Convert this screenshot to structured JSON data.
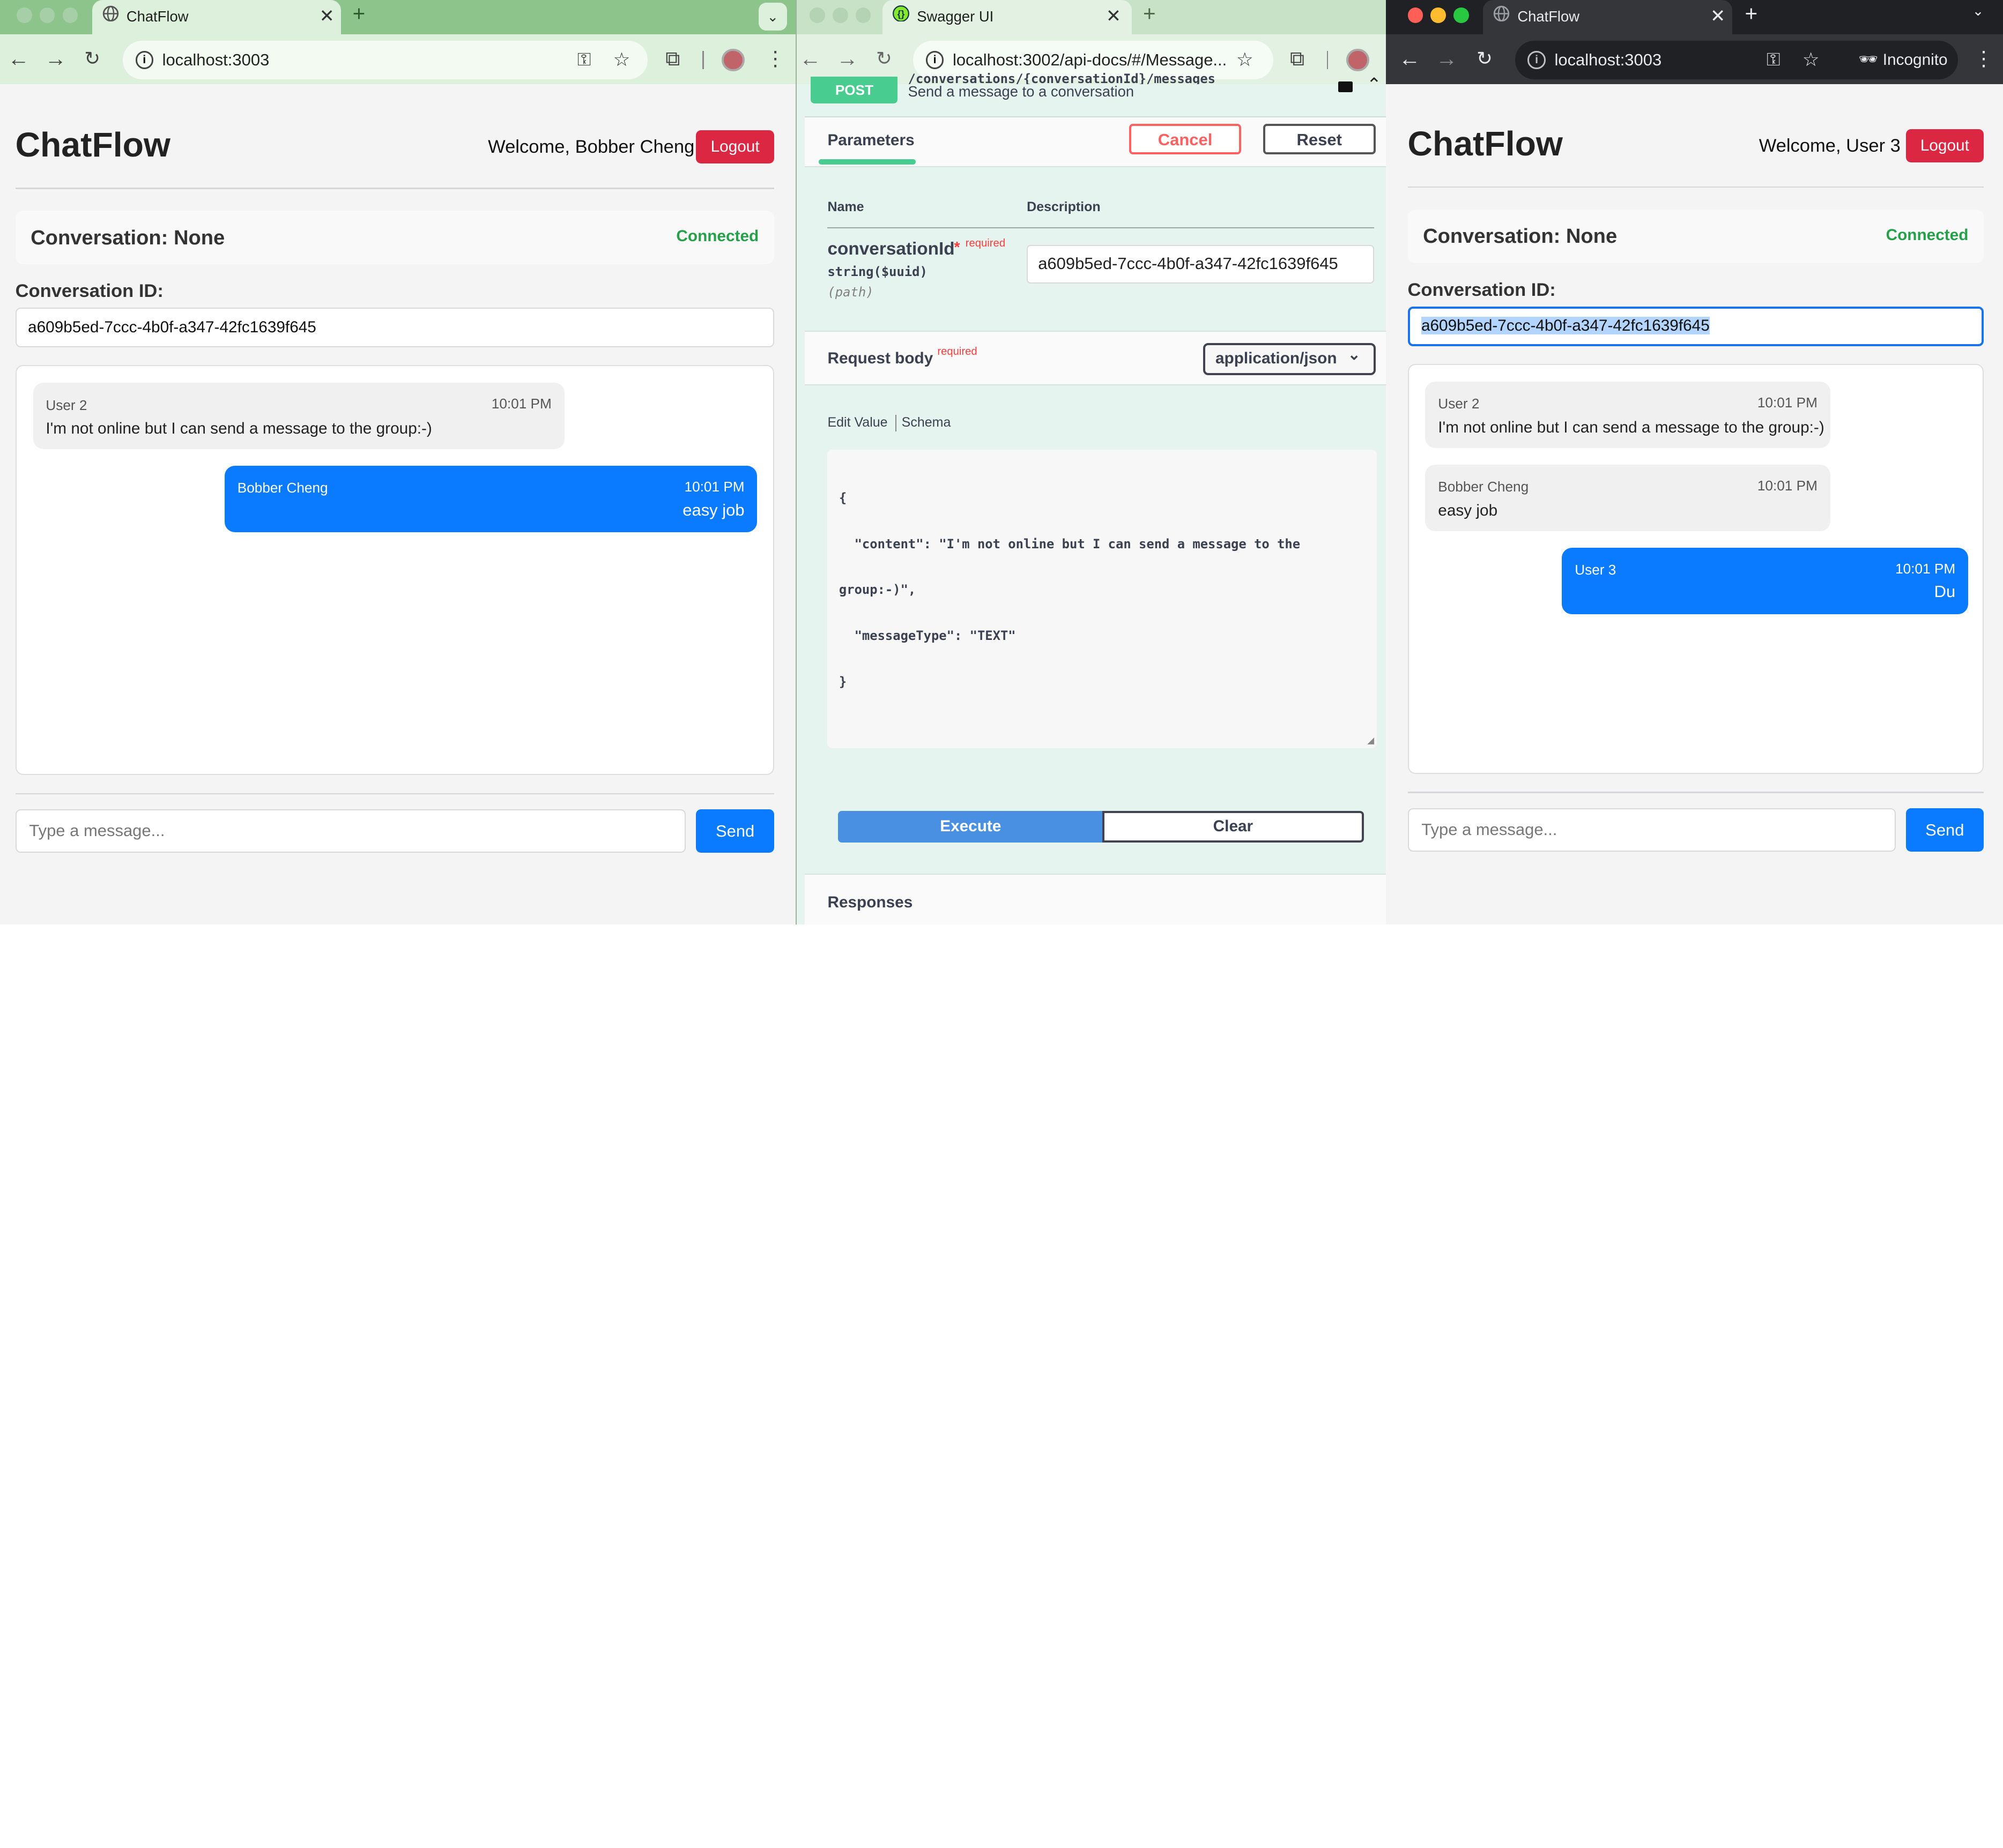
{
  "left": {
    "tab_title": "ChatFlow",
    "url": "localhost:3003",
    "app_title": "ChatFlow",
    "welcome": "Welcome, Bobber Cheng",
    "logout": "Logout",
    "conversation_title": "Conversation: None",
    "status": "Connected",
    "conv_id_label": "Conversation ID:",
    "conv_id_value": "a609b5ed-7ccc-4b0f-a347-42fc1639f645",
    "messages": [
      {
        "from": "User 2",
        "time": "10:01 PM",
        "body": "I'm not online but I can send a message to the group:-)"
      },
      {
        "from": "Bobber Cheng",
        "time": "10:01 PM",
        "body": "easy job"
      }
    ],
    "compose_placeholder": "Type a message...",
    "send": "Send"
  },
  "middle": {
    "tab_title": "Swagger UI",
    "url": "localhost:3002/api-docs/#/Message...",
    "method": "POST",
    "path": "/conversations/{conversationId}/messages",
    "summary": "Send a message to a conversation",
    "parameters_tab": "Parameters",
    "cancel": "Cancel",
    "reset": "Reset",
    "col_name": "Name",
    "col_description": "Description",
    "param_name": "conversationId",
    "param_required_star": "*",
    "param_required": "required",
    "param_type": "string($uuid)",
    "param_in": "(path)",
    "param_value": "a609b5ed-7ccc-4b0f-a347-42fc1639f645",
    "request_body": "Request body",
    "request_body_required": "required",
    "content_type": "application/json",
    "edit_value": "Edit Value",
    "schema": "Schema",
    "body_lines": [
      "{",
      "  \"content\": \"I'm not online but I can send a message to the",
      "group:-)\",",
      "  \"messageType\": \"TEXT\"",
      "}"
    ],
    "execute": "Execute",
    "clear": "Clear",
    "responses": "Responses"
  },
  "right": {
    "tab_title": "ChatFlow",
    "url": "localhost:3003",
    "incognito": "Incognito",
    "app_title": "ChatFlow",
    "welcome": "Welcome, User 3",
    "logout": "Logout",
    "conversation_title": "Conversation: None",
    "status": "Connected",
    "conv_id_label": "Conversation ID:",
    "conv_id_value": "a609b5ed-7ccc-4b0f-a347-42fc1639f645",
    "messages": [
      {
        "from": "User 2",
        "time": "10:01 PM",
        "body": "I'm not online but I can send a message to the group:-)"
      },
      {
        "from": "Bobber Cheng",
        "time": "10:01 PM",
        "body": "easy job"
      },
      {
        "from": "User 3",
        "time": "10:01 PM",
        "body": "Du"
      }
    ],
    "compose_placeholder": "Type a message...",
    "send": "Send"
  },
  "colors": {
    "chrome_green": "#8cc48c",
    "swagger_bg": "#e6f4ef",
    "incognito_frame": "#202124",
    "primary_blue": "#0a7bfe",
    "logout_red": "#dc2743",
    "connected_green": "#27a04a",
    "post_green": "#49cc90"
  }
}
